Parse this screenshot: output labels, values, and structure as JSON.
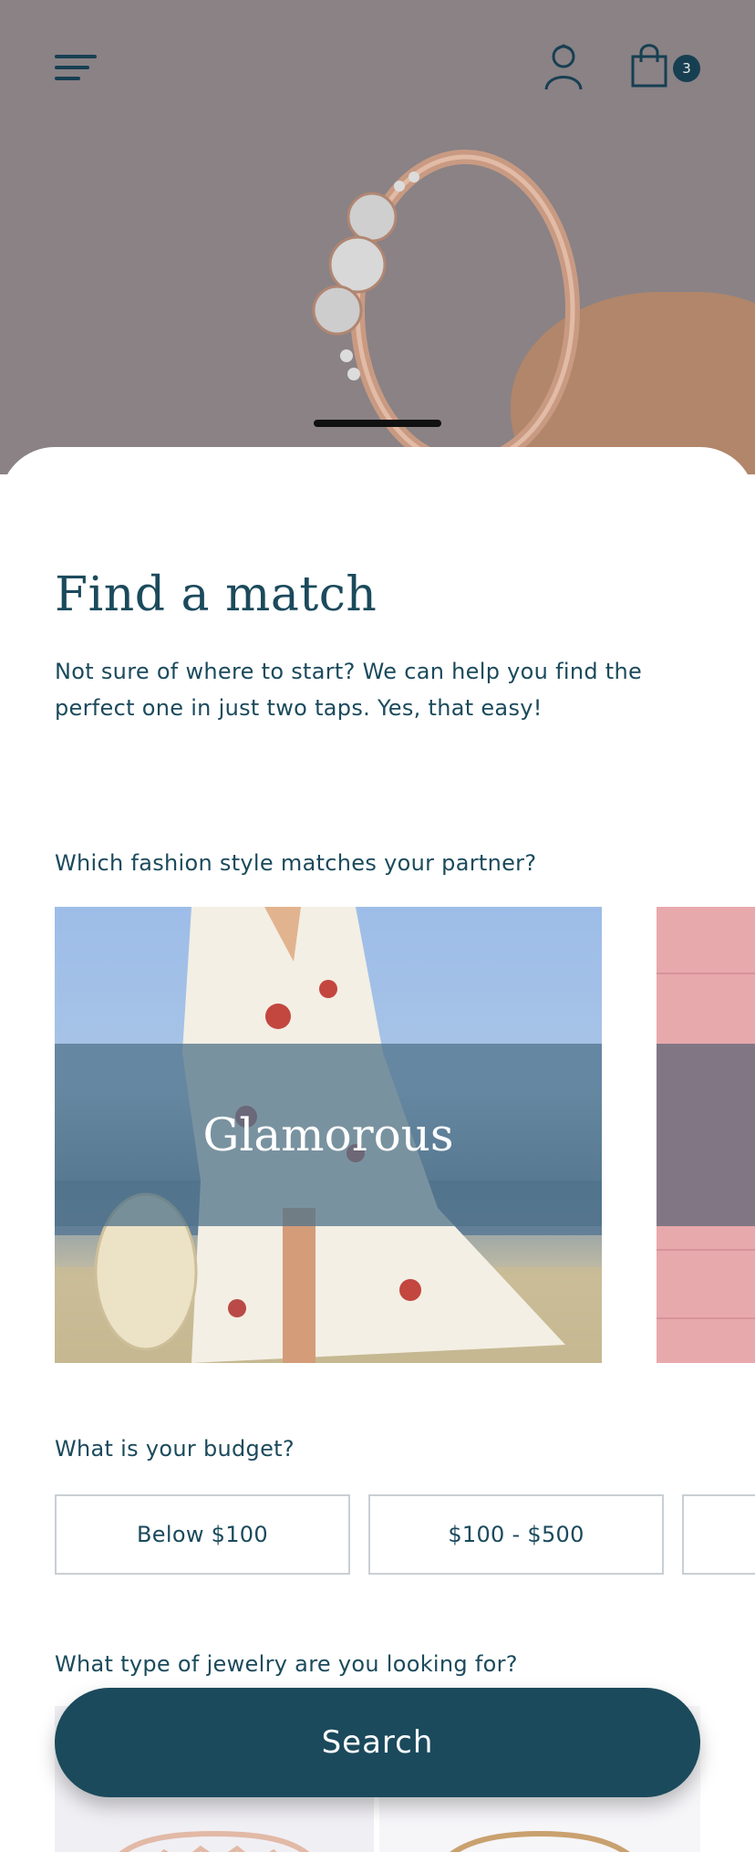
{
  "header": {
    "cart_count": "3",
    "icons": [
      "menu-icon",
      "account-icon",
      "shopping-bag-icon"
    ]
  },
  "hero": {
    "image": "rose-gold-ring-photo"
  },
  "main": {
    "title": "Find a match",
    "intro": "Not sure of where to start? We can help you find the perfect one in just two taps. Yes, that easy!",
    "style_question": "Which fashion style matches your partner?",
    "styles": [
      {
        "label": "Glamorous"
      }
    ],
    "budget_question": "What is your budget?",
    "budget_options": [
      "Below $100",
      "$100 - $500"
    ],
    "jewelry_question": "What type of jewelry are you looking for?",
    "search_label": "Search"
  },
  "colors": {
    "primary": "#1b4a5c",
    "hero_background": "#8a8285",
    "accent_blob": "#b1866a",
    "border": "#c9cfd4"
  }
}
